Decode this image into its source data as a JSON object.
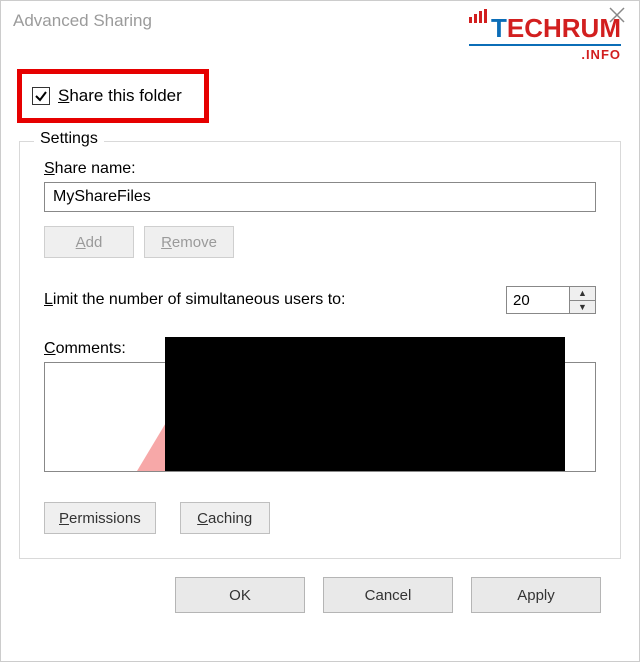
{
  "window": {
    "title": "Advanced Sharing"
  },
  "logo": {
    "name": "TECHRUM",
    "sub": ".INFO"
  },
  "share_checkbox": {
    "checked": true,
    "label_pre": "S",
    "label_rest": "hare this folder"
  },
  "settings": {
    "legend": "Settings",
    "share_name_label_pre": "S",
    "share_name_label_rest": "hare name:",
    "share_name_value": "MyShareFiles",
    "add_btn_pre": "A",
    "add_btn_rest": "dd",
    "remove_btn_pre": "R",
    "remove_btn_rest": "emove",
    "limit_label_pre": "L",
    "limit_label_rest": "imit the number of simultaneous users to:",
    "limit_value": "20",
    "comments_label_pre": "C",
    "comments_label_rest": "omments:",
    "permissions_btn_pre": "P",
    "permissions_btn_rest": "ermissions",
    "caching_btn_pre": "C",
    "caching_btn_rest": "aching"
  },
  "footer": {
    "ok": "OK",
    "cancel": "Cancel",
    "apply": "Apply"
  }
}
